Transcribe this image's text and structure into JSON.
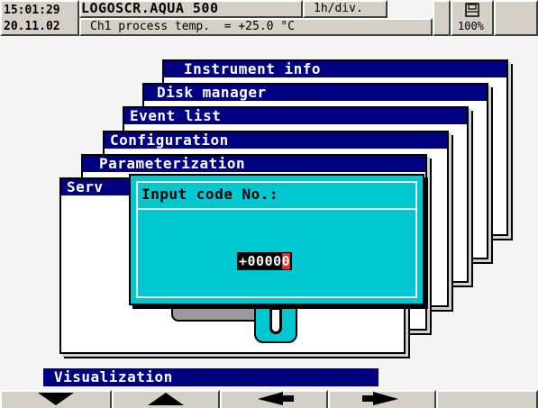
{
  "header": {
    "time": "15:01:29",
    "date": "20.11.02",
    "device_name": "LOGOSCR.AQUA 500",
    "time_base": "1h/div.",
    "channel_reading": "Ch1 process temp.  = +25.0 °C",
    "memory_icon": "memory-card-icon",
    "memory_percent": "100%"
  },
  "menu_stack": [
    {
      "title": "Instrument info"
    },
    {
      "title": "Disk manager"
    },
    {
      "title": "Event list"
    },
    {
      "title": "Configuration"
    },
    {
      "title": "Parameterization"
    },
    {
      "title": "Serv"
    }
  ],
  "dialog": {
    "title": "Input code No.:",
    "code_value": "+0000",
    "code_cursor_digit": "0"
  },
  "status": {
    "label": "Visualization"
  },
  "softkeys": [
    {
      "icon": "arrow-down-icon"
    },
    {
      "icon": "arrow-up-icon"
    },
    {
      "icon": "arrow-left-icon"
    },
    {
      "icon": "arrow-right-icon"
    },
    {
      "icon": "blank"
    }
  ],
  "colors": {
    "title_bar": "#000080",
    "dialog_bg": "#00c8d0",
    "cursor": "#ff2020"
  }
}
